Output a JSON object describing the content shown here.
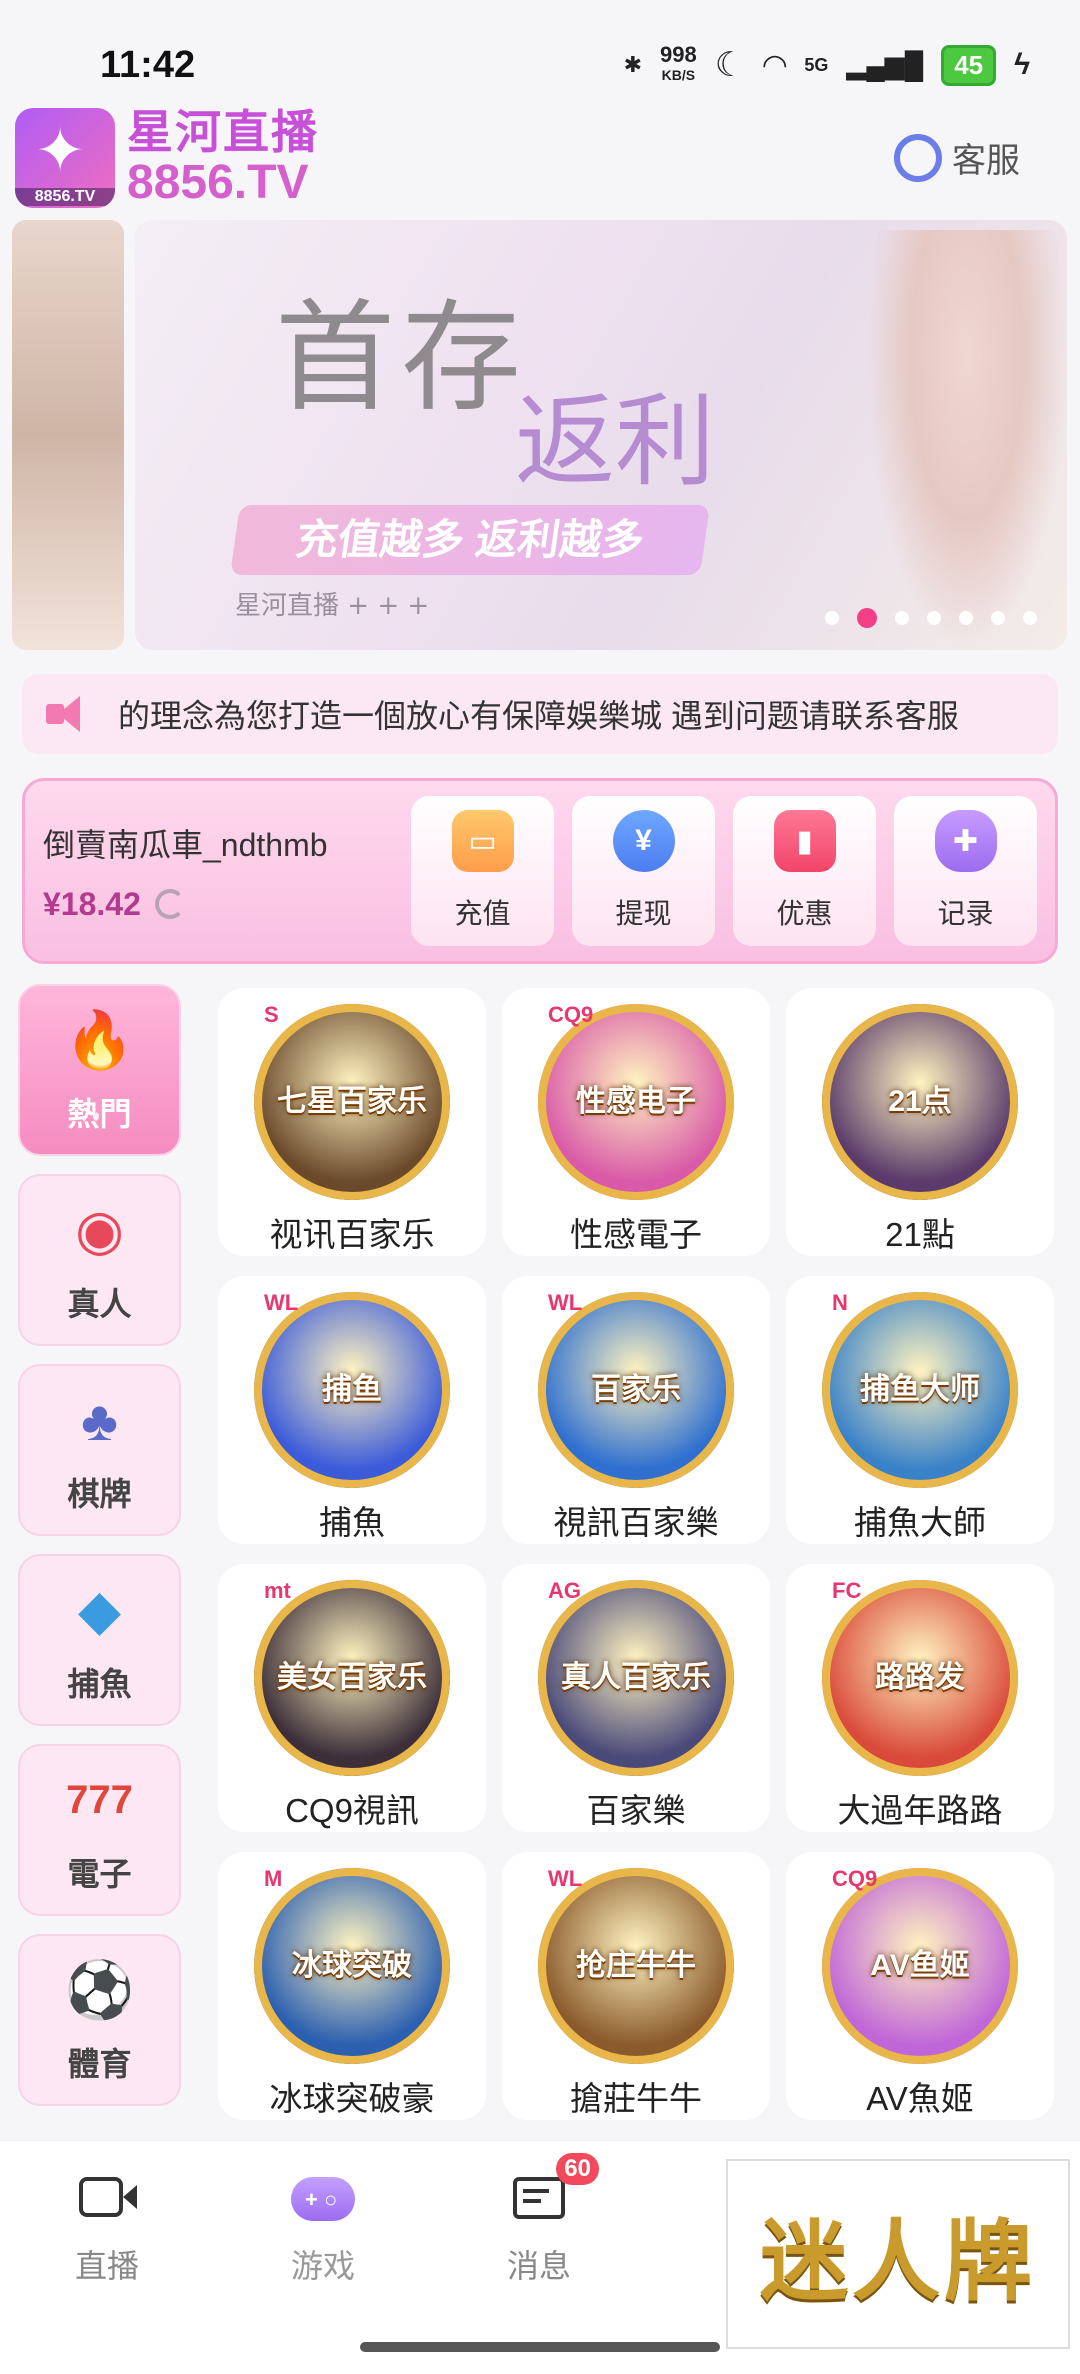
{
  "status_bar": {
    "time": "11:42",
    "net_speed_value": "998",
    "net_speed_unit": "KB/S",
    "signal": "5G",
    "battery": "45"
  },
  "header": {
    "brand_name": "星河直播",
    "brand_domain": "8856.TV",
    "logo_text": "8856.TV",
    "support_label": "客服"
  },
  "banner": {
    "title_main": "首存",
    "title_sub": "返利",
    "slogan": "充值越多 返利越多",
    "footer": "星河直播 + + +",
    "dot_count": 7,
    "active_dot": 1
  },
  "marquee": {
    "text": "的理念為您打造一個放心有保障娛樂城  遇到问题请联系客服"
  },
  "wallet": {
    "username": "倒賣南瓜車_ndthmb",
    "balance": "¥18.42",
    "actions": [
      {
        "label": "充值",
        "icon": "wallet-icon"
      },
      {
        "label": "提现",
        "icon": "yuan-coin-icon"
      },
      {
        "label": "优惠",
        "icon": "ticket-icon"
      },
      {
        "label": "记录",
        "icon": "gamepad-icon"
      }
    ]
  },
  "categories": [
    {
      "label": "熱門",
      "icon": "fire-icon",
      "active": true
    },
    {
      "label": "真人",
      "icon": "poker-chip-icon",
      "active": false
    },
    {
      "label": "棋牌",
      "icon": "playing-cards-icon",
      "active": false
    },
    {
      "label": "捕魚",
      "icon": "shark-icon",
      "active": false
    },
    {
      "label": "電子",
      "icon": "slot-777-icon",
      "active": false
    },
    {
      "label": "體育",
      "icon": "soccer-ball-icon",
      "active": false
    }
  ],
  "games": [
    {
      "name": "视讯百家乐",
      "art": "七星百家乐",
      "provider": "S",
      "color": "#6b4a2c"
    },
    {
      "name": "性感電子",
      "art": "性感电子",
      "provider": "CQ9",
      "color": "#d95aa8"
    },
    {
      "name": "21點",
      "art": "21点",
      "provider": "",
      "color": "#5a3b6b"
    },
    {
      "name": "捕魚",
      "art": "捕鱼",
      "provider": "WL",
      "color": "#3b5bd9"
    },
    {
      "name": "視訊百家樂",
      "art": "百家乐",
      "provider": "WL",
      "color": "#2e6fd0"
    },
    {
      "name": "捕魚大師",
      "art": "捕鱼大师",
      "provider": "N",
      "color": "#3a82c8"
    },
    {
      "name": "CQ9視訊",
      "art": "美女百家乐",
      "provider": "mt",
      "color": "#3c2f3a"
    },
    {
      "name": "百家樂",
      "art": "真人百家乐",
      "provider": "AG",
      "color": "#4a4a7a"
    },
    {
      "name": "大過年路路",
      "art": "路路发",
      "provider": "FC",
      "color": "#d94a3a"
    },
    {
      "name": "冰球突破豪",
      "art": "冰球突破",
      "provider": "M",
      "color": "#2b5fb0"
    },
    {
      "name": "搶莊牛牛",
      "art": "抢庄牛牛",
      "provider": "WL",
      "color": "#8a5a2c"
    },
    {
      "name": "AV魚姬",
      "art": "AV鱼姬",
      "provider": "CQ9",
      "color": "#c066d8"
    }
  ],
  "bottom_nav": [
    {
      "label": "直播",
      "icon": "camera-icon"
    },
    {
      "label": "游戏",
      "icon": "gamepad-icon"
    },
    {
      "label": "消息",
      "icon": "message-icon",
      "badge": "60"
    }
  ],
  "ad": {
    "text": "迷人牌"
  },
  "colors": {
    "accent": "#f23f86",
    "brand_purple": "#c84fd8",
    "balance": "#b43a8e"
  }
}
